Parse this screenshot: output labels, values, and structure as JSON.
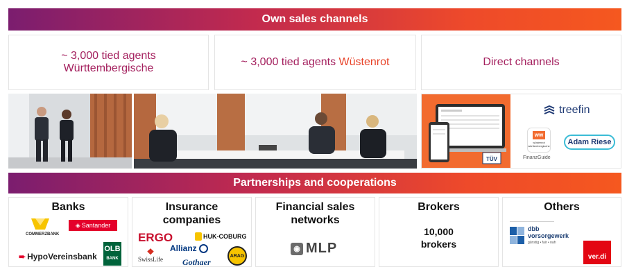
{
  "own_channels": {
    "title": "Own sales channels",
    "box1_line1": "~ 3,000 tied agents",
    "box1_line2": "Württembergische",
    "box2_prefix": "~ 3,000 tied agents ",
    "box2_brand": "Wüstenrot",
    "box3": "Direct channels"
  },
  "digital": {
    "treefin": "treefin",
    "adam_riese": "Adam Riese",
    "finanzguide": "FinanzGuide",
    "ww_badge": "ww",
    "ww_text": "wüstenrot württembergische"
  },
  "partnerships": {
    "title": "Partnerships and cooperations",
    "banks": {
      "title": "Banks",
      "commerzbank": "COMMERZBANK",
      "santander": "Santander",
      "hypovereinsbank": "HypoVereinsbank",
      "olb1": "OLB",
      "olb2": "BANK"
    },
    "insurance": {
      "title1": "Insurance",
      "title2": "companies",
      "ergo": "ERGO",
      "huk": "HUK-COBURG",
      "allianz": "Allianz",
      "swisslife": "SwissLife",
      "gothaer": "Gothaer",
      "arag": "ARAG"
    },
    "financial": {
      "title1": "Financial sales",
      "title2": "networks",
      "mlp": "MLP"
    },
    "brokers": {
      "title": "Brokers",
      "count": "10,000",
      "label": "brokers"
    },
    "others": {
      "title": "Others",
      "dbb1": "dbb",
      "dbb2": "vorsorgewerk",
      "dbb3": "günstig • fair • nah",
      "verdi": "ver.di"
    }
  },
  "colors": {
    "wine": "#a4205e",
    "orange": "#e8442a",
    "band_start": "#7b1d6f",
    "band_end": "#f5581f"
  }
}
